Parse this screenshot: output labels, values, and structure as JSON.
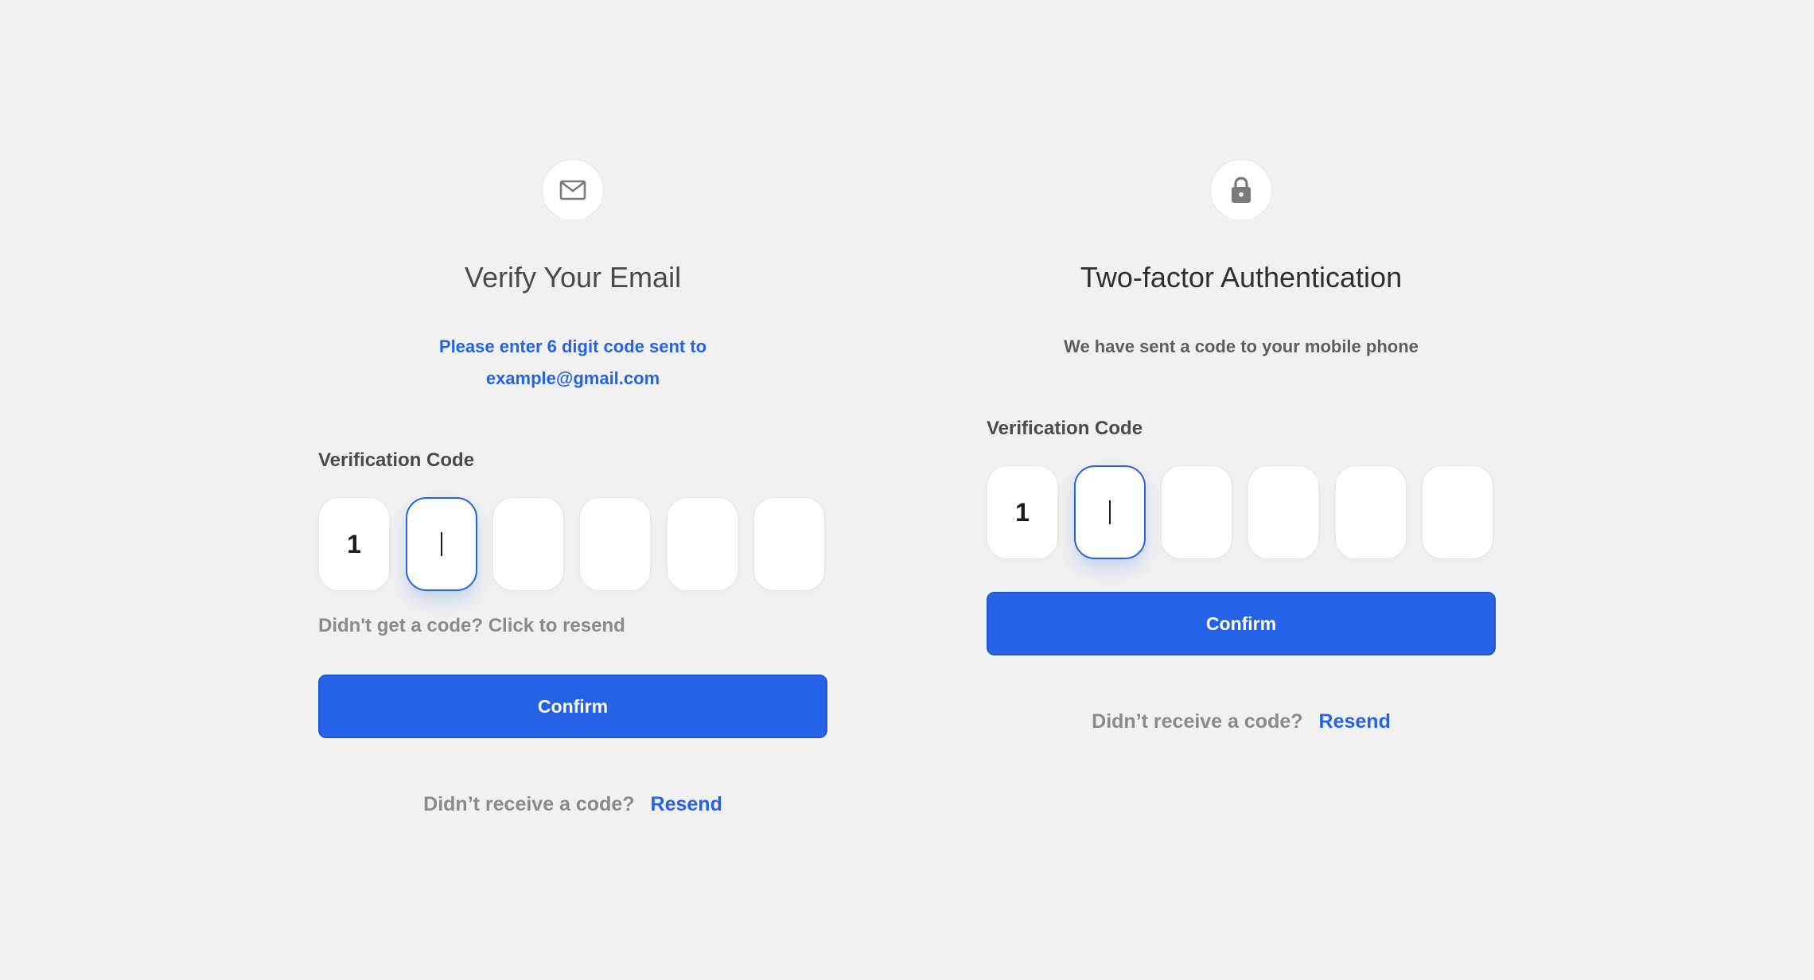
{
  "colors": {
    "background": "#f1f1f1",
    "accent": "#2462e8",
    "muted_text": "#8a8a8a",
    "heading_text": "#4a4a4a"
  },
  "email_card": {
    "icon": "mail-icon",
    "title": "Verify Your Email",
    "subtitle_line1": "Please enter 6 digit  code sent to",
    "subtitle_line2": "example@gmail.com",
    "code_label": "Verification Code",
    "code_digits": [
      "1",
      "",
      "",
      "",
      "",
      ""
    ],
    "active_index": 1,
    "resend_hint": "Didn't get a code? Click to resend",
    "confirm_label": "Confirm",
    "footer_text": "Didn’t receive a code?",
    "footer_link": "Resend"
  },
  "twofa_card": {
    "icon": "lock-icon",
    "title": "Two-factor Authentication",
    "subtitle": "We have sent a code to your mobile phone",
    "code_label": "Verification Code",
    "code_digits": [
      "1",
      "",
      "",
      "",
      "",
      ""
    ],
    "active_index": 1,
    "confirm_label": "Confirm",
    "footer_text": "Didn’t receive a code?",
    "footer_link": "Resend"
  }
}
